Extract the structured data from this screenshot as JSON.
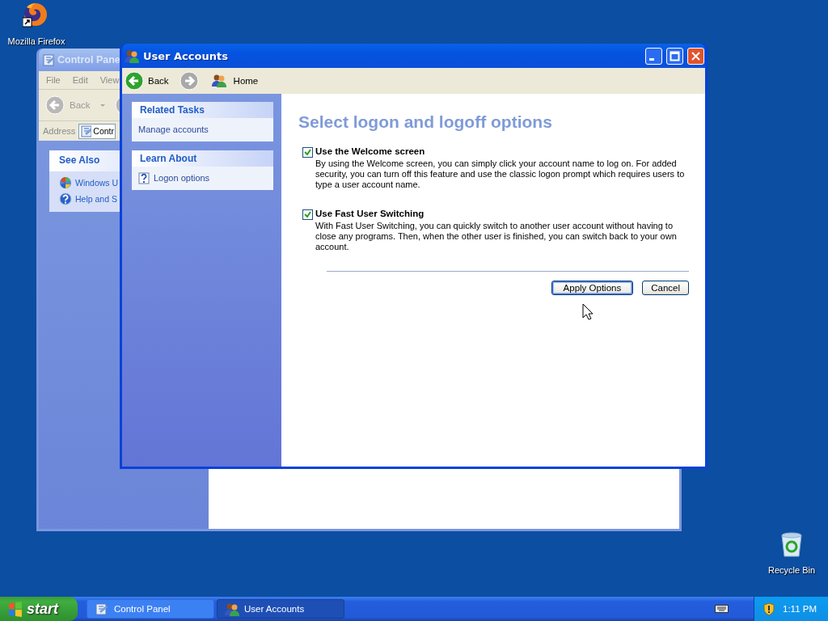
{
  "desktop_icons": [
    {
      "kind": "firefox",
      "label": "Mozilla Firefox"
    },
    {
      "kind": "recycle",
      "label": "Recycle Bin"
    }
  ],
  "back_window": {
    "title": "Control Pane",
    "menu": [
      "File",
      "Edit",
      "View"
    ],
    "back": "Back",
    "address_label": "Address",
    "address_value": "Contr",
    "see_also": {
      "title": "See Also",
      "items": [
        {
          "kind": "update",
          "label": "Windows U"
        },
        {
          "kind": "help",
          "label": "Help and S"
        }
      ]
    }
  },
  "window": {
    "title": "User Accounts",
    "nav": {
      "back": "Back",
      "home": "Home"
    },
    "sidebar": [
      {
        "title": "Related Tasks",
        "items": [
          {
            "kind": "link",
            "label": "Manage accounts"
          }
        ]
      },
      {
        "title": "Learn About",
        "items": [
          {
            "kind": "help",
            "label": "Logon options"
          }
        ]
      }
    ],
    "heading": "Select logon and logoff options",
    "options": [
      {
        "label": "Use the Welcome screen",
        "checked": true,
        "description": "By using the Welcome screen, you can simply click your account name to log on. For added security, you can turn off this feature and use the classic logon prompt which requires users to type a user account name."
      },
      {
        "label": "Use Fast User Switching",
        "checked": true,
        "description": "With Fast User Switching, you can quickly switch to another user account without having to close any programs. Then, when the other user is finished, you can switch back to your own account."
      }
    ],
    "buttons": [
      {
        "label": "Apply Options",
        "default": true
      },
      {
        "label": "Cancel",
        "default": false
      }
    ]
  },
  "taskbar": {
    "start": "start",
    "items": [
      {
        "kind": "control",
        "label": "Control Panel",
        "selected": false
      },
      {
        "kind": "users",
        "label": "User Accounts",
        "selected": true
      }
    ],
    "clock": "1:11 PM"
  }
}
